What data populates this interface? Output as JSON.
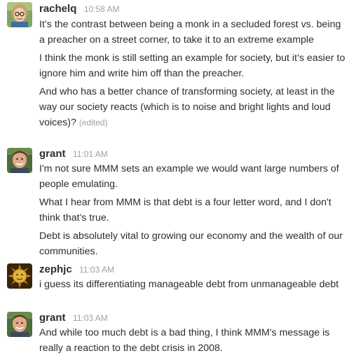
{
  "colors": {
    "text": "#2c2d30",
    "meta": "#9e9ea6",
    "background": "#ffffff"
  },
  "messages": [
    {
      "user": "rachelq",
      "time": "10:58 AM",
      "avatar_icon": "woman-with-glasses-avatar",
      "lines": [
        "It’s the contrast between being a monk in a secluded forest vs. being a preacher on a street corner, to take it to an extreme example",
        "I think the monk is still setting an example for society, but it’s easier to ignore him and write him off than the preacher.",
        "And who has a better chance of transforming society, at least in the way our society reacts (which is to noise and bright lights and loud voices)?"
      ],
      "edited_label": "(edited)"
    },
    {
      "user": "grant",
      "time": "11:01 AM",
      "avatar_icon": "man-smiling-avatar",
      "lines": [
        "I'm not sure MMM sets an example we would want large numbers of people emulating.",
        "What I hear from MMM is that debt is a four letter word, and I don't think that's true.",
        "Debt is absolutely vital to growing our economy and the wealth of our communities."
      ]
    },
    {
      "user": "zephjc",
      "time": "11:03 AM",
      "avatar_icon": "golden-sun-face-avatar",
      "lines": [
        "i guess its differentiating manageable debt from unmanageable debt"
      ]
    },
    {
      "user": "grant",
      "time": "11:03 AM",
      "avatar_icon": "man-smiling-avatar",
      "lines": [
        "And while too much debt is a bad thing, I think MMM's message is really a reaction to the debt crisis in 2008."
      ]
    }
  ]
}
